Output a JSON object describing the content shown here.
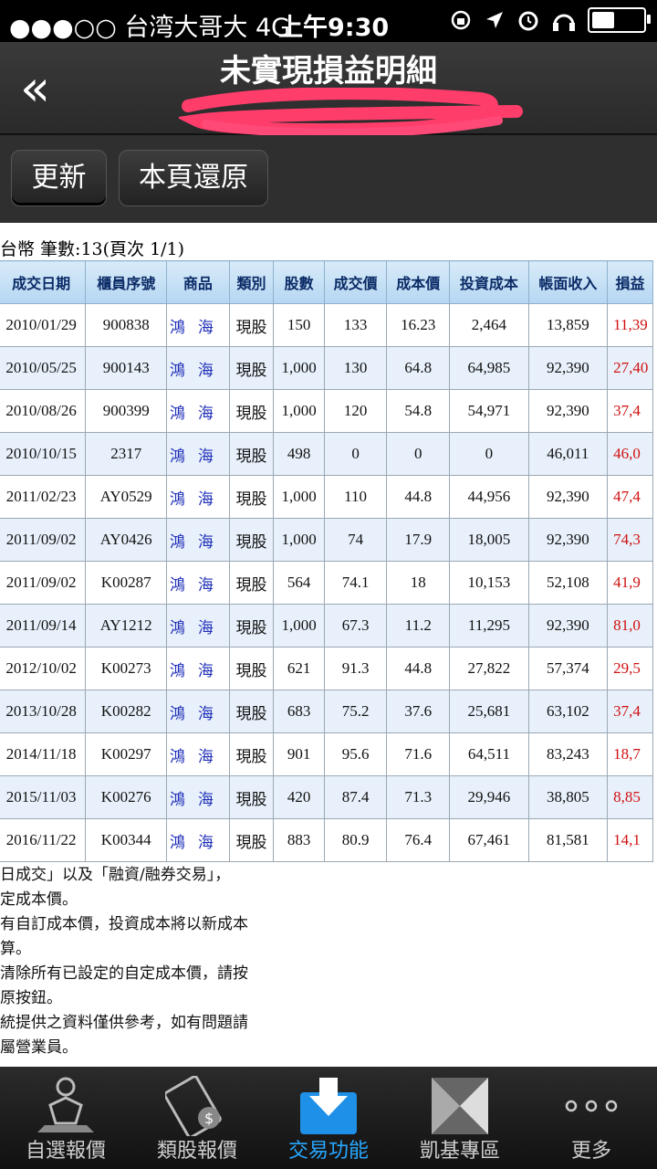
{
  "status": {
    "signal": "●●●○○",
    "carrier": "台湾大哥大",
    "network": "4G",
    "time": "上午9:30"
  },
  "nav": {
    "back_glyph": "«",
    "title": "未實現損益明細"
  },
  "toolbar": {
    "refresh_label": "更新",
    "restore_label": "本頁還原"
  },
  "summary": "台幣 筆數:13(頁次 1/1)",
  "table": {
    "headers": [
      "成交日期",
      "櫃員序號",
      "商品",
      "類別",
      "股數",
      "成交價",
      "成本價",
      "投資成本",
      "帳面收入",
      "損益"
    ],
    "rows": [
      [
        "2010/01/29",
        "900838",
        "鴻海",
        "現股",
        "150",
        "133",
        "16.23",
        "2,464",
        "13,859",
        "11,39"
      ],
      [
        "2010/05/25",
        "900143",
        "鴻海",
        "現股",
        "1,000",
        "130",
        "64.8",
        "64,985",
        "92,390",
        "27,40"
      ],
      [
        "2010/08/26",
        "900399",
        "鴻海",
        "現股",
        "1,000",
        "120",
        "54.8",
        "54,971",
        "92,390",
        "37,4"
      ],
      [
        "2010/10/15",
        "2317",
        "鴻海",
        "現股",
        "498",
        "0",
        "0",
        "0",
        "46,011",
        "46,0"
      ],
      [
        "2011/02/23",
        "AY0529",
        "鴻海",
        "現股",
        "1,000",
        "110",
        "44.8",
        "44,956",
        "92,390",
        "47,4"
      ],
      [
        "2011/09/02",
        "AY0426",
        "鴻海",
        "現股",
        "1,000",
        "74",
        "17.9",
        "18,005",
        "92,390",
        "74,3"
      ],
      [
        "2011/09/02",
        "K00287",
        "鴻海",
        "現股",
        "564",
        "74.1",
        "18",
        "10,153",
        "52,108",
        "41,9"
      ],
      [
        "2011/09/14",
        "AY1212",
        "鴻海",
        "現股",
        "1,000",
        "67.3",
        "11.2",
        "11,295",
        "92,390",
        "81,0"
      ],
      [
        "2012/10/02",
        "K00273",
        "鴻海",
        "現股",
        "621",
        "91.3",
        "44.8",
        "27,822",
        "57,374",
        "29,5"
      ],
      [
        "2013/10/28",
        "K00282",
        "鴻海",
        "現股",
        "683",
        "75.2",
        "37.6",
        "25,681",
        "63,102",
        "37,4"
      ],
      [
        "2014/11/18",
        "K00297",
        "鴻海",
        "現股",
        "901",
        "95.6",
        "71.6",
        "64,511",
        "83,243",
        "18,7"
      ],
      [
        "2015/11/03",
        "K00276",
        "鴻海",
        "現股",
        "420",
        "87.4",
        "71.3",
        "29,946",
        "38,805",
        "8,85"
      ],
      [
        "2016/11/22",
        "K00344",
        "鴻海",
        "現股",
        "883",
        "80.9",
        "76.4",
        "67,461",
        "81,581",
        "14,1"
      ]
    ]
  },
  "notes": [
    "日成交」以及「融資/融券交易」，",
    "定成本價。",
    "有自訂成本價，投資成本將以新成本",
    "算。",
    "清除所有已設定的自定成本價，請按",
    "原按鈕。",
    "統提供之資料僅供參考，如有問題請",
    "屬營業員。"
  ],
  "tabs": [
    {
      "label": "自選報價",
      "icon": "person-chart-icon"
    },
    {
      "label": "類股報價",
      "icon": "film-dollar-icon"
    },
    {
      "label": "交易功能",
      "icon": "download-tray-icon"
    },
    {
      "label": "凱基專區",
      "icon": "kgi-logo-icon"
    },
    {
      "label": "更多",
      "icon": "more-dots-icon"
    }
  ],
  "colors": {
    "accent": "#28a8ff",
    "loss_profit_red": "#d01010",
    "header_blue": "#b5d6f2"
  }
}
